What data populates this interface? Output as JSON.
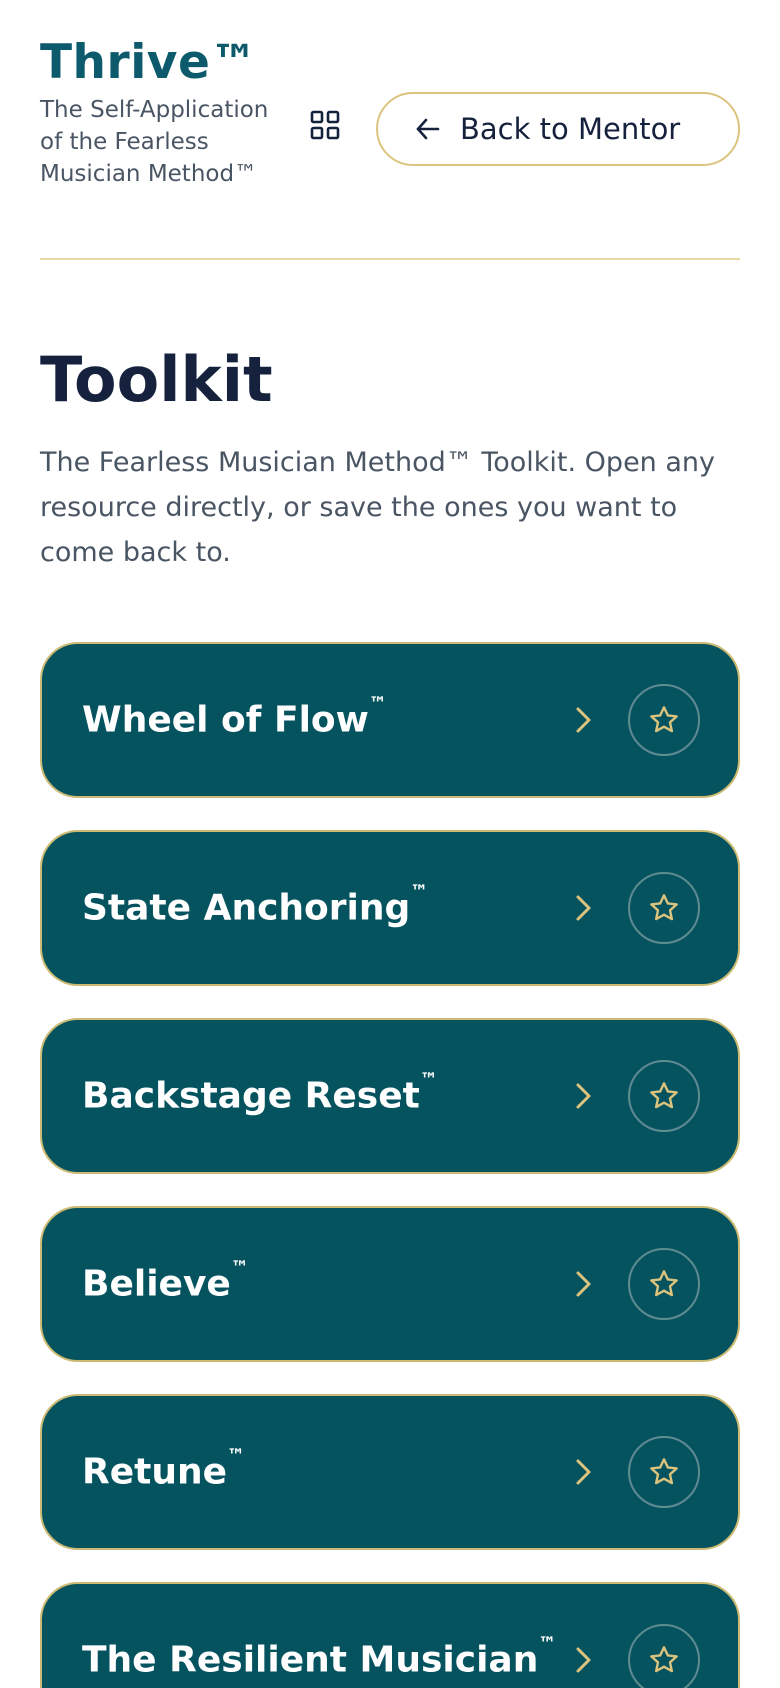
{
  "header": {
    "brand_title": "Thrive™",
    "brand_subtitle": "The Self-Application of the Fearless Musician Method™",
    "grid_icon": "grid-icon",
    "back_button_label": "Back to Mentor",
    "back_icon": "arrow-left-icon"
  },
  "main": {
    "title": "Toolkit",
    "description": "The Fearless Musician Method™ Toolkit. Open any resource directly, or save the ones you want to come back to."
  },
  "toolkit_items": [
    {
      "name": "Wheel of Flow",
      "mark": "™"
    },
    {
      "name": "State Anchoring",
      "mark": "™"
    },
    {
      "name": "Backstage Reset",
      "mark": "™"
    },
    {
      "name": "Believe",
      "mark": "™"
    },
    {
      "name": "Retune",
      "mark": "™"
    },
    {
      "name": "The Resilient Musician",
      "mark": "™"
    }
  ],
  "colors": {
    "brand": "#0c5a6b",
    "card_bg": "#05535f",
    "gold_accent": "#dcc47e",
    "heading": "#16213d",
    "body_text": "#4a5563"
  },
  "icons": {
    "open": "chevron-right-icon",
    "favorite": "star-outline-icon"
  }
}
